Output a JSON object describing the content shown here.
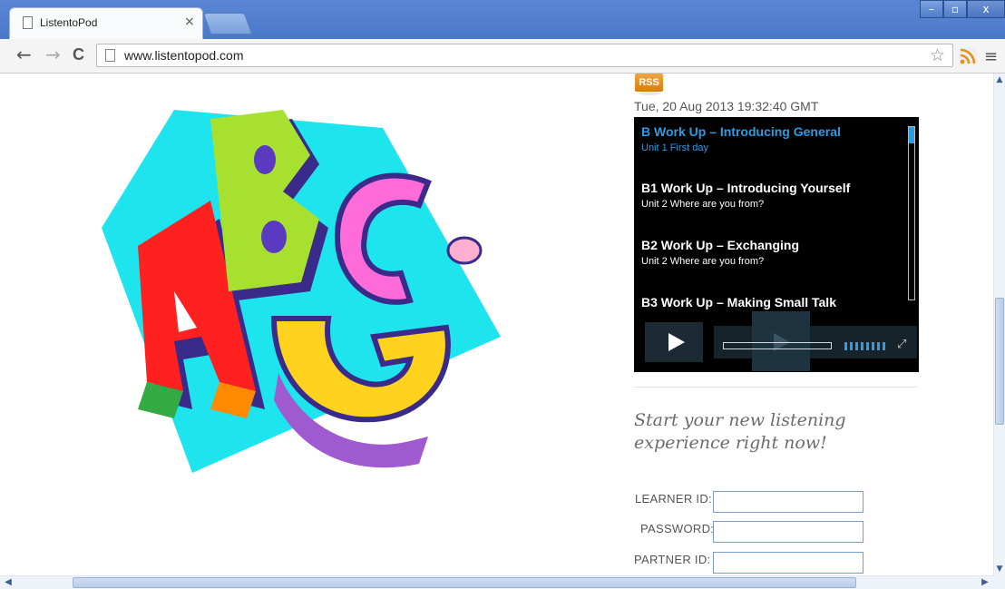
{
  "browser": {
    "tab_title": "ListentoPod",
    "tab_close": "×",
    "url": "www.listentopod.com",
    "window_min": "–",
    "window_max": "▫",
    "window_close": "x",
    "back_glyph": "←",
    "forward_glyph": "→",
    "reload_glyph": "C",
    "star_glyph": "☆",
    "menu_glyph": "≡"
  },
  "page": {
    "rss_label": "RSS",
    "pub_date": "Tue, 20 Aug 2013 19:32:40 GMT",
    "playlist": [
      {
        "title": "B Work Up – Introducing General",
        "subtitle": "Unit 1  First day",
        "active": true
      },
      {
        "title": "B1 Work Up – Introducing Yourself",
        "subtitle": "Unit 2  Where are you from?",
        "active": false
      },
      {
        "title": "B2 Work Up – Exchanging",
        "subtitle": "Unit 2  Where are you from?",
        "active": false
      },
      {
        "title": "B3 Work Up – Making Small Talk",
        "subtitle": "",
        "active": false
      }
    ],
    "tagline": "Start your new listening experience right now!",
    "form": {
      "learner_label": "LEARNER ID:",
      "learner_value": "",
      "password_label": "PASSWORD:",
      "password_value": "",
      "partner_label": "PARTNER ID:",
      "partner_value": ""
    }
  },
  "colors": {
    "accent_blue": "#2f9be0",
    "rss_orange": "#e8901e",
    "titlebar": "#4a79c9"
  }
}
